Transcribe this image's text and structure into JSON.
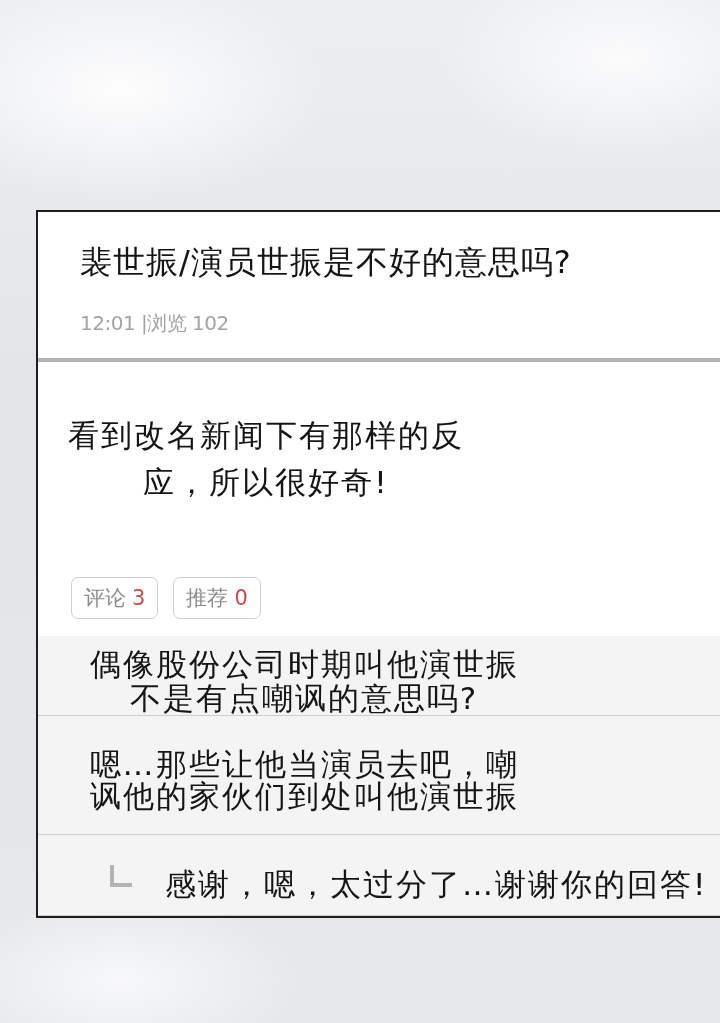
{
  "post": {
    "title": "裴世振/演员世振是不好的意思吗?",
    "meta": "12:01 |浏览 102",
    "body": "看到改名新闻下有那样的反应，所以很好奇!",
    "actions": [
      {
        "label": "评论",
        "count": "3"
      },
      {
        "label": "推荐",
        "count": "0"
      }
    ]
  },
  "comments": [
    {
      "kind": "comment",
      "text": "偶像股份公司时期叫他演世振不是有点嘲讽的意思吗?"
    },
    {
      "kind": "comment",
      "text": "嗯…那些让他当演员去吧，嘲讽他的家伙们到处叫他演世振"
    },
    {
      "kind": "reply",
      "text": "感谢，嗯，太过分了…谢谢你的回答!"
    }
  ]
}
